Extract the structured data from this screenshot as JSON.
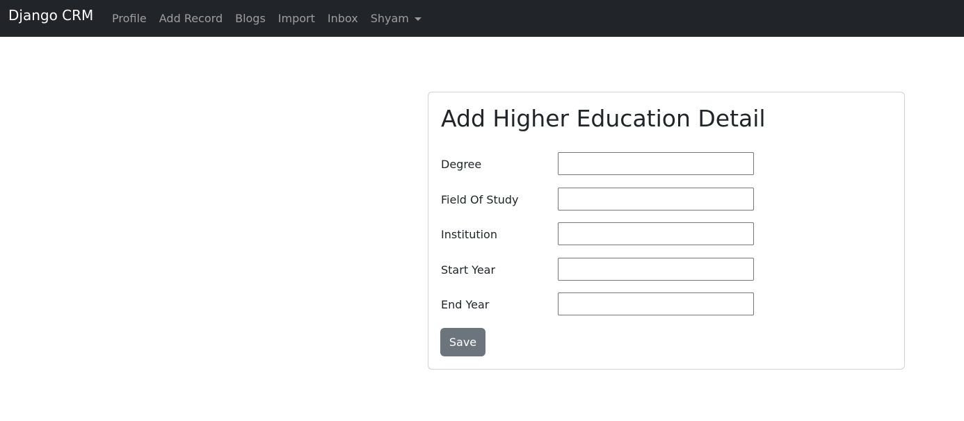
{
  "navbar": {
    "brand": "Django CRM",
    "links": [
      "Profile",
      "Add Record",
      "Blogs",
      "Import",
      "Inbox"
    ],
    "user_menu": "Shyam",
    "background_color": "#212529"
  },
  "form": {
    "title": "Add Higher Education Detail",
    "fields": [
      {
        "label": "Degree",
        "value": ""
      },
      {
        "label": "Field Of Study",
        "value": ""
      },
      {
        "label": "Institution",
        "value": ""
      },
      {
        "label": "Start Year",
        "value": ""
      },
      {
        "label": "End Year",
        "value": ""
      }
    ],
    "submit_label": "Save",
    "submit_color": "#6c757d"
  }
}
